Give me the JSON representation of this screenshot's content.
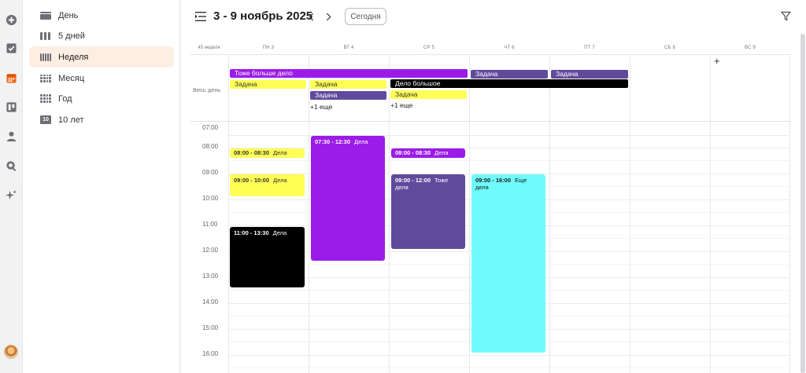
{
  "rail": {
    "icons": [
      "add-icon",
      "checkbox-icon",
      "calendar-icon",
      "board-icon",
      "user-icon",
      "search-icon",
      "sparkle-icon"
    ],
    "accent": "#f26b21"
  },
  "sidebar": {
    "items": [
      {
        "label": "День",
        "icon": "view-day-icon"
      },
      {
        "label": "5 дней",
        "icon": "view-5days-icon"
      },
      {
        "label": "Неделя",
        "icon": "view-week-icon",
        "active": true
      },
      {
        "label": "Месяц",
        "icon": "view-month-icon"
      },
      {
        "label": "Год",
        "icon": "view-year-icon"
      },
      {
        "label": "10 лет",
        "icon": "view-10years-icon",
        "badge": "10"
      }
    ]
  },
  "header": {
    "range_title": "3 - 9 ноябрь 2025",
    "today_label": "Сегодня"
  },
  "calendar": {
    "week_label": "45 неделя",
    "days": [
      "ПН 3",
      "ВТ 4",
      "СР 5",
      "ЧТ 6",
      "ПТ 7",
      "СБ 8",
      "ВС 9"
    ],
    "allday_label": "Весь день",
    "more_mon": "+1 еще",
    "more_tue": "+1 еще",
    "hours": [
      "07:00",
      "08:00",
      "09:00",
      "10:00",
      "11:00",
      "12:00",
      "13:00",
      "14:00",
      "15:00",
      "16:00"
    ],
    "allday_events": [
      {
        "title": "Тоже больше дело",
        "color": "#9b1be8",
        "text": "#ffffff"
      },
      {
        "title": "Задача",
        "color": "#ffff55",
        "text": "#333333"
      },
      {
        "title": "Задача",
        "color": "#ffff55",
        "text": "#333333"
      },
      {
        "title": "Задача",
        "color": "#604a9c",
        "text": "#ffffff"
      },
      {
        "title": "Дело большое",
        "color": "#000000",
        "text": "#ffffff"
      },
      {
        "title": "Задача",
        "color": "#ffff55",
        "text": "#333333"
      },
      {
        "title": "Задача",
        "color": "#604a9c",
        "text": "#ffffff"
      },
      {
        "title": "Задача",
        "color": "#604a9c",
        "text": "#ffffff"
      }
    ],
    "events": [
      {
        "time": "08:00 - 08:30",
        "title": "Дела",
        "color": "#ffff55",
        "text": "#333333"
      },
      {
        "time": "09:00 - 10:00",
        "title": "Дела",
        "color": "#ffff55",
        "text": "#333333"
      },
      {
        "time": "11:00 - 13:30",
        "title": "Дела",
        "color": "#000000",
        "text": "#ffffff"
      },
      {
        "time": "07:30 - 12:30",
        "title": "Дела",
        "color": "#9b1be8",
        "text": "#ffffff"
      },
      {
        "time": "08:00 - 08:30",
        "title": "Дела",
        "color": "#9b1be8",
        "text": "#ffffff"
      },
      {
        "time": "09:00 - 12:00",
        "title": "Тоже дела",
        "color": "#604a9c",
        "text": "#ffffff"
      },
      {
        "time": "09:00 - 16:00",
        "title": "Еще дела",
        "color": "#6ffbfc",
        "text": "#1a1a1a"
      }
    ]
  }
}
